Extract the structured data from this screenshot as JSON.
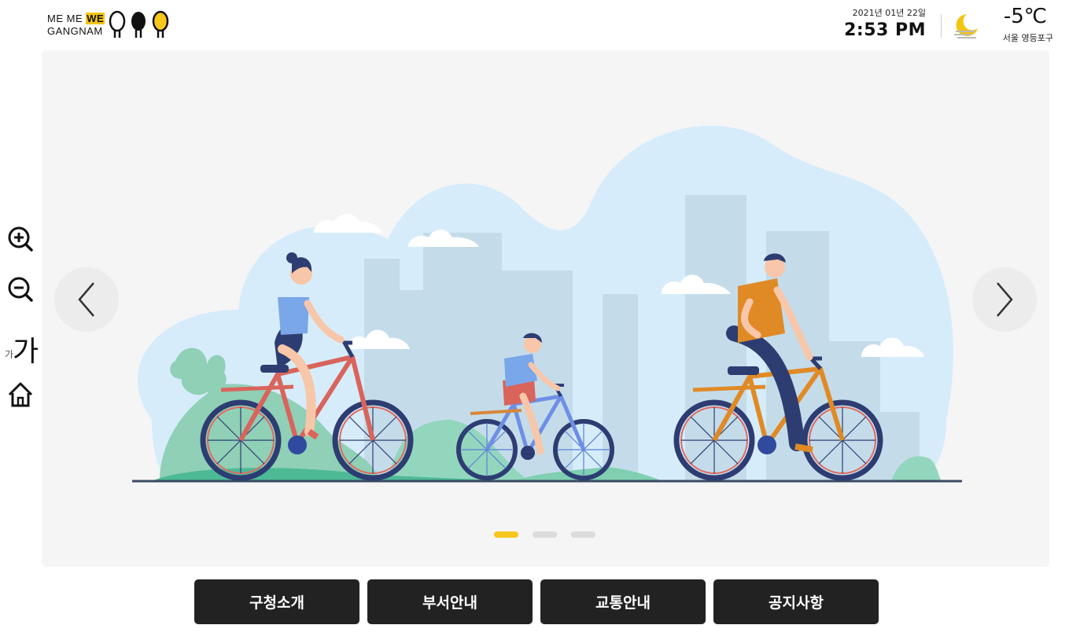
{
  "brand": {
    "line1": "ME ME ",
    "we": "WE",
    "line2": "GANGNAM"
  },
  "header": {
    "date": "2021년 01년 22일",
    "time": "2:53 PM",
    "temperature": "-5℃",
    "location": "서울 영등포구",
    "weather_icon": "moon-cloud-icon"
  },
  "side_tools": {
    "zoom_in_icon": "zoom-in-icon",
    "zoom_out_icon": "zoom-out-icon",
    "font_small": "가",
    "font_large": "가",
    "home_icon": "home-icon"
  },
  "carousel": {
    "prev_icon": "chevron-left-icon",
    "next_icon": "chevron-right-icon",
    "slide_count": 3,
    "active_index": 0
  },
  "nav": {
    "items": [
      {
        "label": "구청소개"
      },
      {
        "label": "부서안내"
      },
      {
        "label": "교통안내"
      },
      {
        "label": "공지사항"
      }
    ]
  },
  "colors": {
    "accent": "#f6c71c",
    "nav_bg": "#222222",
    "banner_bg": "#f5f5f5",
    "sky": "#d6ecfa"
  }
}
